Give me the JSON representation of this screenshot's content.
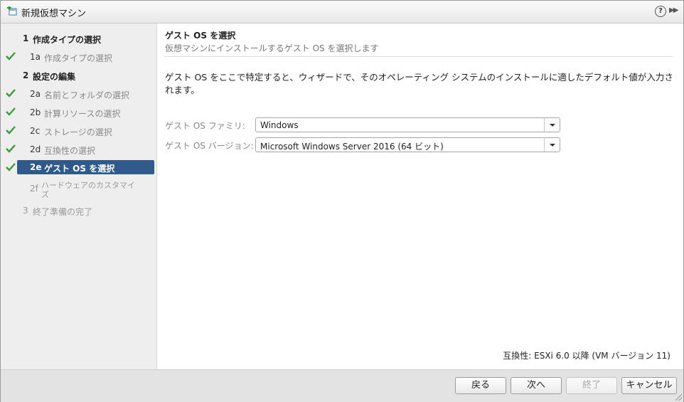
{
  "window": {
    "title": "新規仮想マシン",
    "help_glyph": "?",
    "expand_glyph": "▶▶"
  },
  "sidebar": {
    "steps": [
      {
        "num": "1",
        "label": "作成タイプの選択",
        "state": "head"
      },
      {
        "num": "1a",
        "label": "作成タイプの選択",
        "state": "done"
      },
      {
        "num": "2",
        "label": "設定の編集",
        "state": "head"
      },
      {
        "num": "2a",
        "label": "名前とフォルダの選択",
        "state": "done"
      },
      {
        "num": "2b",
        "label": "計算リソースの選択",
        "state": "done"
      },
      {
        "num": "2c",
        "label": "ストレージの選択",
        "state": "done"
      },
      {
        "num": "2d",
        "label": "互換性の選択",
        "state": "done"
      },
      {
        "num": "2e",
        "label": "ゲスト OS を選択",
        "state": "active"
      },
      {
        "num": "2f",
        "label": "ハードウェアのカスタマイ",
        "label2": "ズ",
        "state": "future"
      },
      {
        "num": "3",
        "label": "終了準備の完了",
        "state": "future"
      }
    ]
  },
  "main": {
    "title": "ゲスト OS を選択",
    "subtitle": "仮想マシンにインストールするゲスト OS を選択します",
    "description": "ゲスト OS をここで特定すると、ウィザードで、そのオペレーティング システムのインストールに適したデフォルト値が入力されます。",
    "family_label": "ゲスト OS ファミリ:",
    "family_value": "Windows",
    "version_label": "ゲスト OS バージョン:",
    "version_value": "Microsoft Windows Server 2016 (64 ビット)",
    "compatibility": "互換性: ESXi 6.0 以降 (VM バージョン 11)"
  },
  "footer": {
    "back": "戻る",
    "next": "次へ",
    "finish": "終了",
    "cancel": "キャンセル"
  },
  "colors": {
    "active_step": "#2f5a8a",
    "check": "#3a9a3a"
  }
}
